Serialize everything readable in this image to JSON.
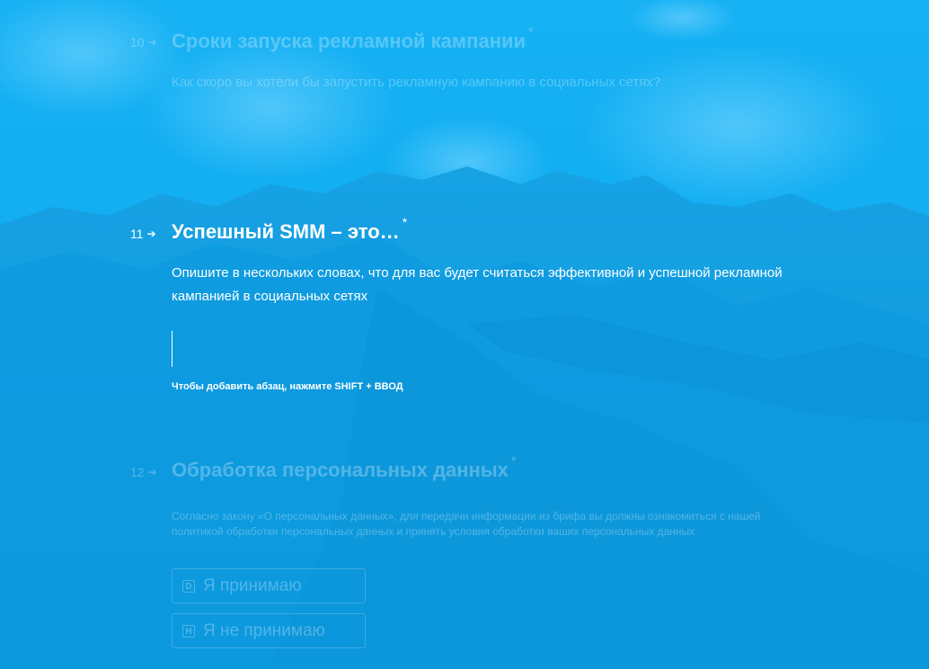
{
  "colors": {
    "background": "#0eaaf0",
    "text": "#ffffff"
  },
  "questions": [
    {
      "number": "10",
      "arrow": "➔",
      "title": "Сроки запуска рекламной кампании",
      "required_mark": "*",
      "description": "Как скоро вы хотели бы запустить рекламную кампанию в социальных сетях?"
    },
    {
      "number": "11",
      "arrow": "➔",
      "title": "Успешный SMM – это…",
      "required_mark": "*",
      "description": "Опишите в нескольких словах, что для вас будет считаться эффективной и успешной рекламной кампанией в социальных сетях",
      "answer_value": "",
      "hint_prefix": "Чтобы добавить абзац, нажмите",
      "hint_keys": "SHIFT + ВВОД"
    },
    {
      "number": "12",
      "arrow": "➔",
      "title": "Обработка персональных данных",
      "required_mark": "*",
      "description": "Согласно закону «О персональных данных», для передачи информации из брифа вы должны ознакомиться с нашей политикой обработки персональных данных и принять условия обработки ваших персональных данных.",
      "choices": [
        {
          "key": "D",
          "label": "Я принимаю"
        },
        {
          "key": "H",
          "label": "Я не принимаю"
        }
      ]
    }
  ]
}
